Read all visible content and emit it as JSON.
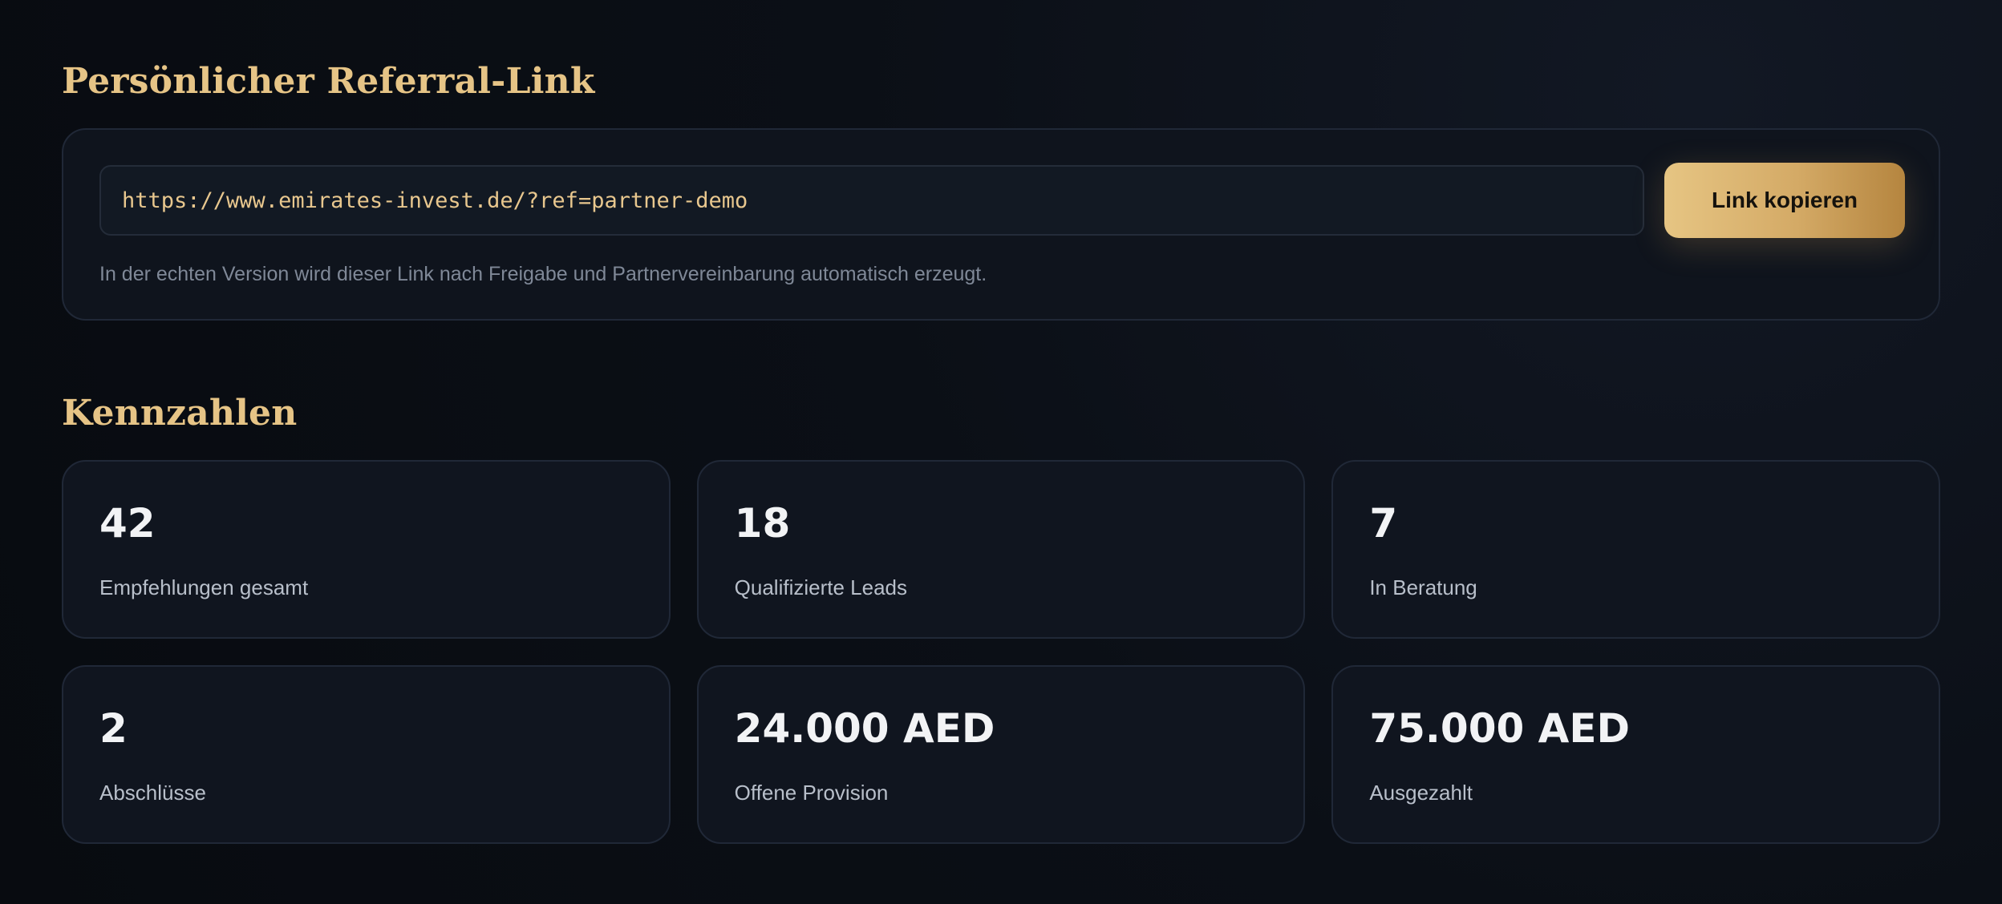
{
  "referral": {
    "title": "Persönlicher Referral-Link",
    "link_value": "https://www.emirates-invest.de/?ref=partner-demo",
    "copy_label": "Link kopieren",
    "hint": "In der echten Version wird dieser Link nach Freigabe und Partnervereinbarung automatisch erzeugt."
  },
  "stats": {
    "title": "Kennzahlen",
    "items": [
      {
        "value": "42",
        "label": "Empfehlungen gesamt"
      },
      {
        "value": "18",
        "label": "Qualifizierte Leads"
      },
      {
        "value": "7",
        "label": "In Beratung"
      },
      {
        "value": "2",
        "label": "Abschlüsse"
      },
      {
        "value": "24.000 AED",
        "label": "Offene Provision"
      },
      {
        "value": "75.000 AED",
        "label": "Ausgezahlt"
      }
    ]
  },
  "colors": {
    "accent": "#e6c486",
    "background": "#0b0f16",
    "card": "#10151f"
  }
}
